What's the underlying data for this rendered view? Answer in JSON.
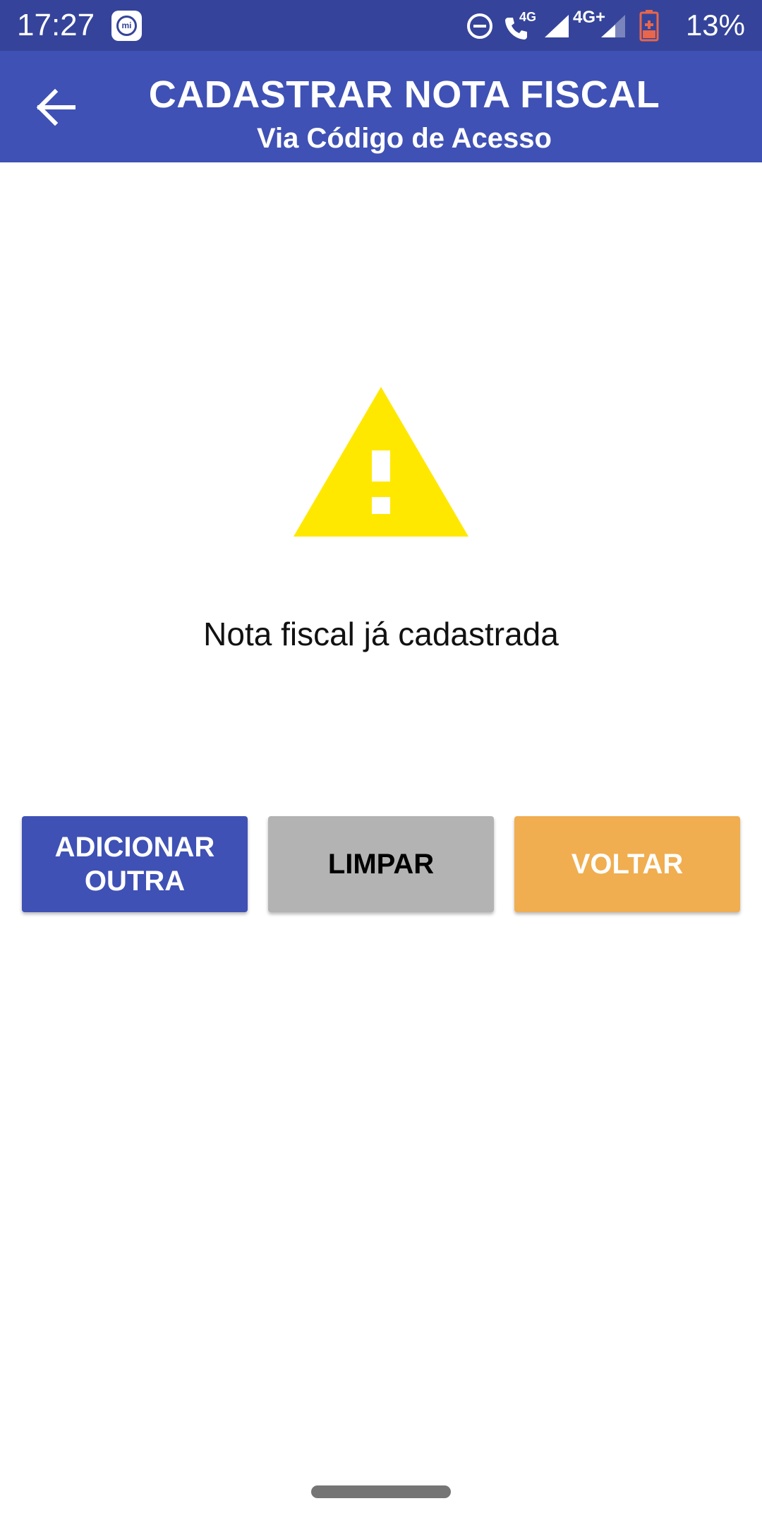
{
  "status_bar": {
    "time": "17:27",
    "app_badge": "mi",
    "network_small": "4G",
    "network_main": "4G+",
    "battery_percent": "13%",
    "icons": [
      "mi-app-icon",
      "do-not-disturb-icon",
      "volte-call-icon",
      "signal-icon",
      "signal-weak-icon",
      "battery-low-icon"
    ]
  },
  "app_bar": {
    "back_icon": "arrow-back-icon",
    "title": "CADASTRAR NOTA FISCAL",
    "subtitle": "Via Código de Acesso"
  },
  "content": {
    "icon": "warning-icon",
    "message": "Nota fiscal já cadastrada"
  },
  "buttons": {
    "add_another": "ADICIONAR OUTRA",
    "clear": "LIMPAR",
    "back": "VOLTAR"
  },
  "colors": {
    "status_bar": "#35449a",
    "primary": "#3f51b5",
    "warning": "#ffe800",
    "clear_button": "#b3b3b3",
    "back_button": "#f0ae50"
  }
}
